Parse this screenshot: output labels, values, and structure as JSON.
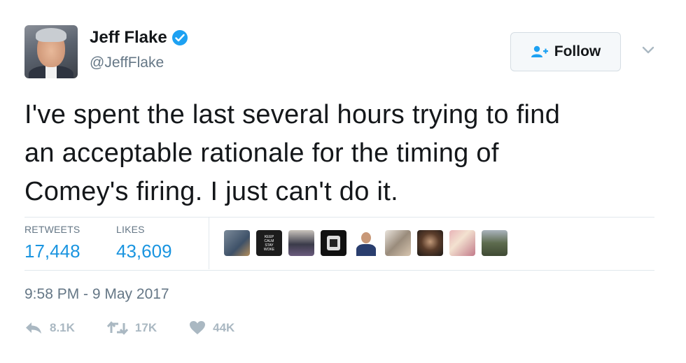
{
  "user": {
    "name": "Jeff Flake",
    "handle": "@JeffFlake",
    "verified": true
  },
  "follow_button": {
    "label": "Follow"
  },
  "tweet": {
    "text_lines": [
      "I've spent the last several hours trying to find",
      "an acceptable rationale for the timing of",
      "Comey's firing. I just can't do it."
    ]
  },
  "stats": {
    "retweets_label": "RETWEETS",
    "retweets_value": "17,448",
    "likes_label": "LIKES",
    "likes_value": "43,609"
  },
  "likers": {
    "keep_calm_text": [
      "KEEP",
      "CALM",
      "STAY",
      "WOKE"
    ]
  },
  "timestamp": "9:58 PM - 9 May 2017",
  "actions": {
    "reply_count": "8.1K",
    "retweet_count": "17K",
    "like_count": "44K"
  },
  "colors": {
    "accent": "#1b95e0",
    "verified": "#1da1f2",
    "muted": "#657786",
    "action_icon": "#aab8c2"
  }
}
